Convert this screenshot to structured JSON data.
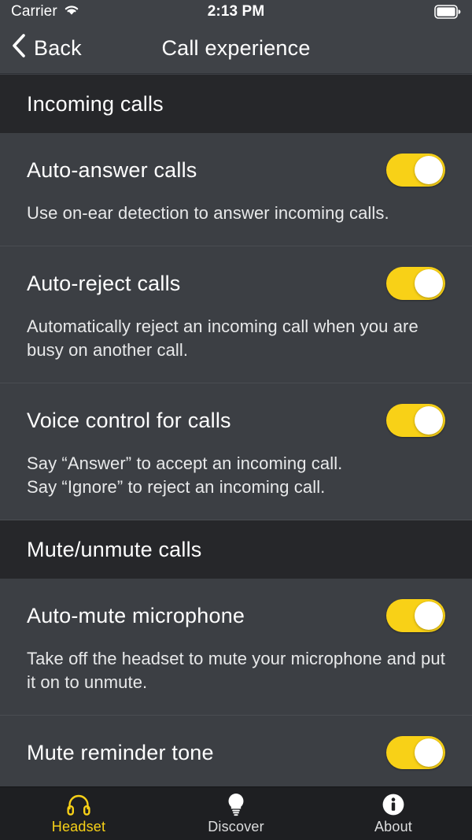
{
  "status_bar": {
    "carrier": "Carrier",
    "time": "2:13 PM",
    "wifi_icon": "wifi-icon",
    "battery_icon": "battery-full-icon"
  },
  "nav_bar": {
    "back_label": "Back",
    "back_icon": "chevron-left-icon",
    "title": "Call experience"
  },
  "colors": {
    "accent": "#F8D117",
    "row_bg": "#3C3F44",
    "section_header_bg": "#26272A",
    "nav_bg": "#3F4247",
    "tab_bar_bg": "#1E1F22",
    "text_primary": "#FFFFFF",
    "toggle_on": "#F8D117",
    "toggle_knob": "#FFFFFF"
  },
  "sections": [
    {
      "header": "Incoming calls",
      "rows": [
        {
          "title": "Auto-answer calls",
          "description": "Use on-ear detection to answer incoming calls.",
          "toggle_state": "on"
        },
        {
          "title": "Auto-reject calls",
          "description": "Automatically reject an incoming call when you are busy on another call.",
          "toggle_state": "on"
        },
        {
          "title": "Voice control for calls",
          "description": "Say “Answer” to accept an incoming call.\nSay “Ignore” to reject an incoming call.",
          "toggle_state": "on"
        }
      ]
    },
    {
      "header": "Mute/unmute calls",
      "rows": [
        {
          "title": "Auto-mute microphone",
          "description": "Take off the headset to mute your microphone and put it on to unmute.",
          "toggle_state": "on"
        },
        {
          "title": "Mute reminder tone",
          "description": "",
          "toggle_state": "on"
        }
      ]
    }
  ],
  "tab_bar": {
    "tabs": [
      {
        "label": "Headset",
        "icon": "headset-icon",
        "active": true
      },
      {
        "label": "Discover",
        "icon": "lightbulb-icon",
        "active": false
      },
      {
        "label": "About",
        "icon": "info-circle-icon",
        "active": false
      }
    ]
  }
}
